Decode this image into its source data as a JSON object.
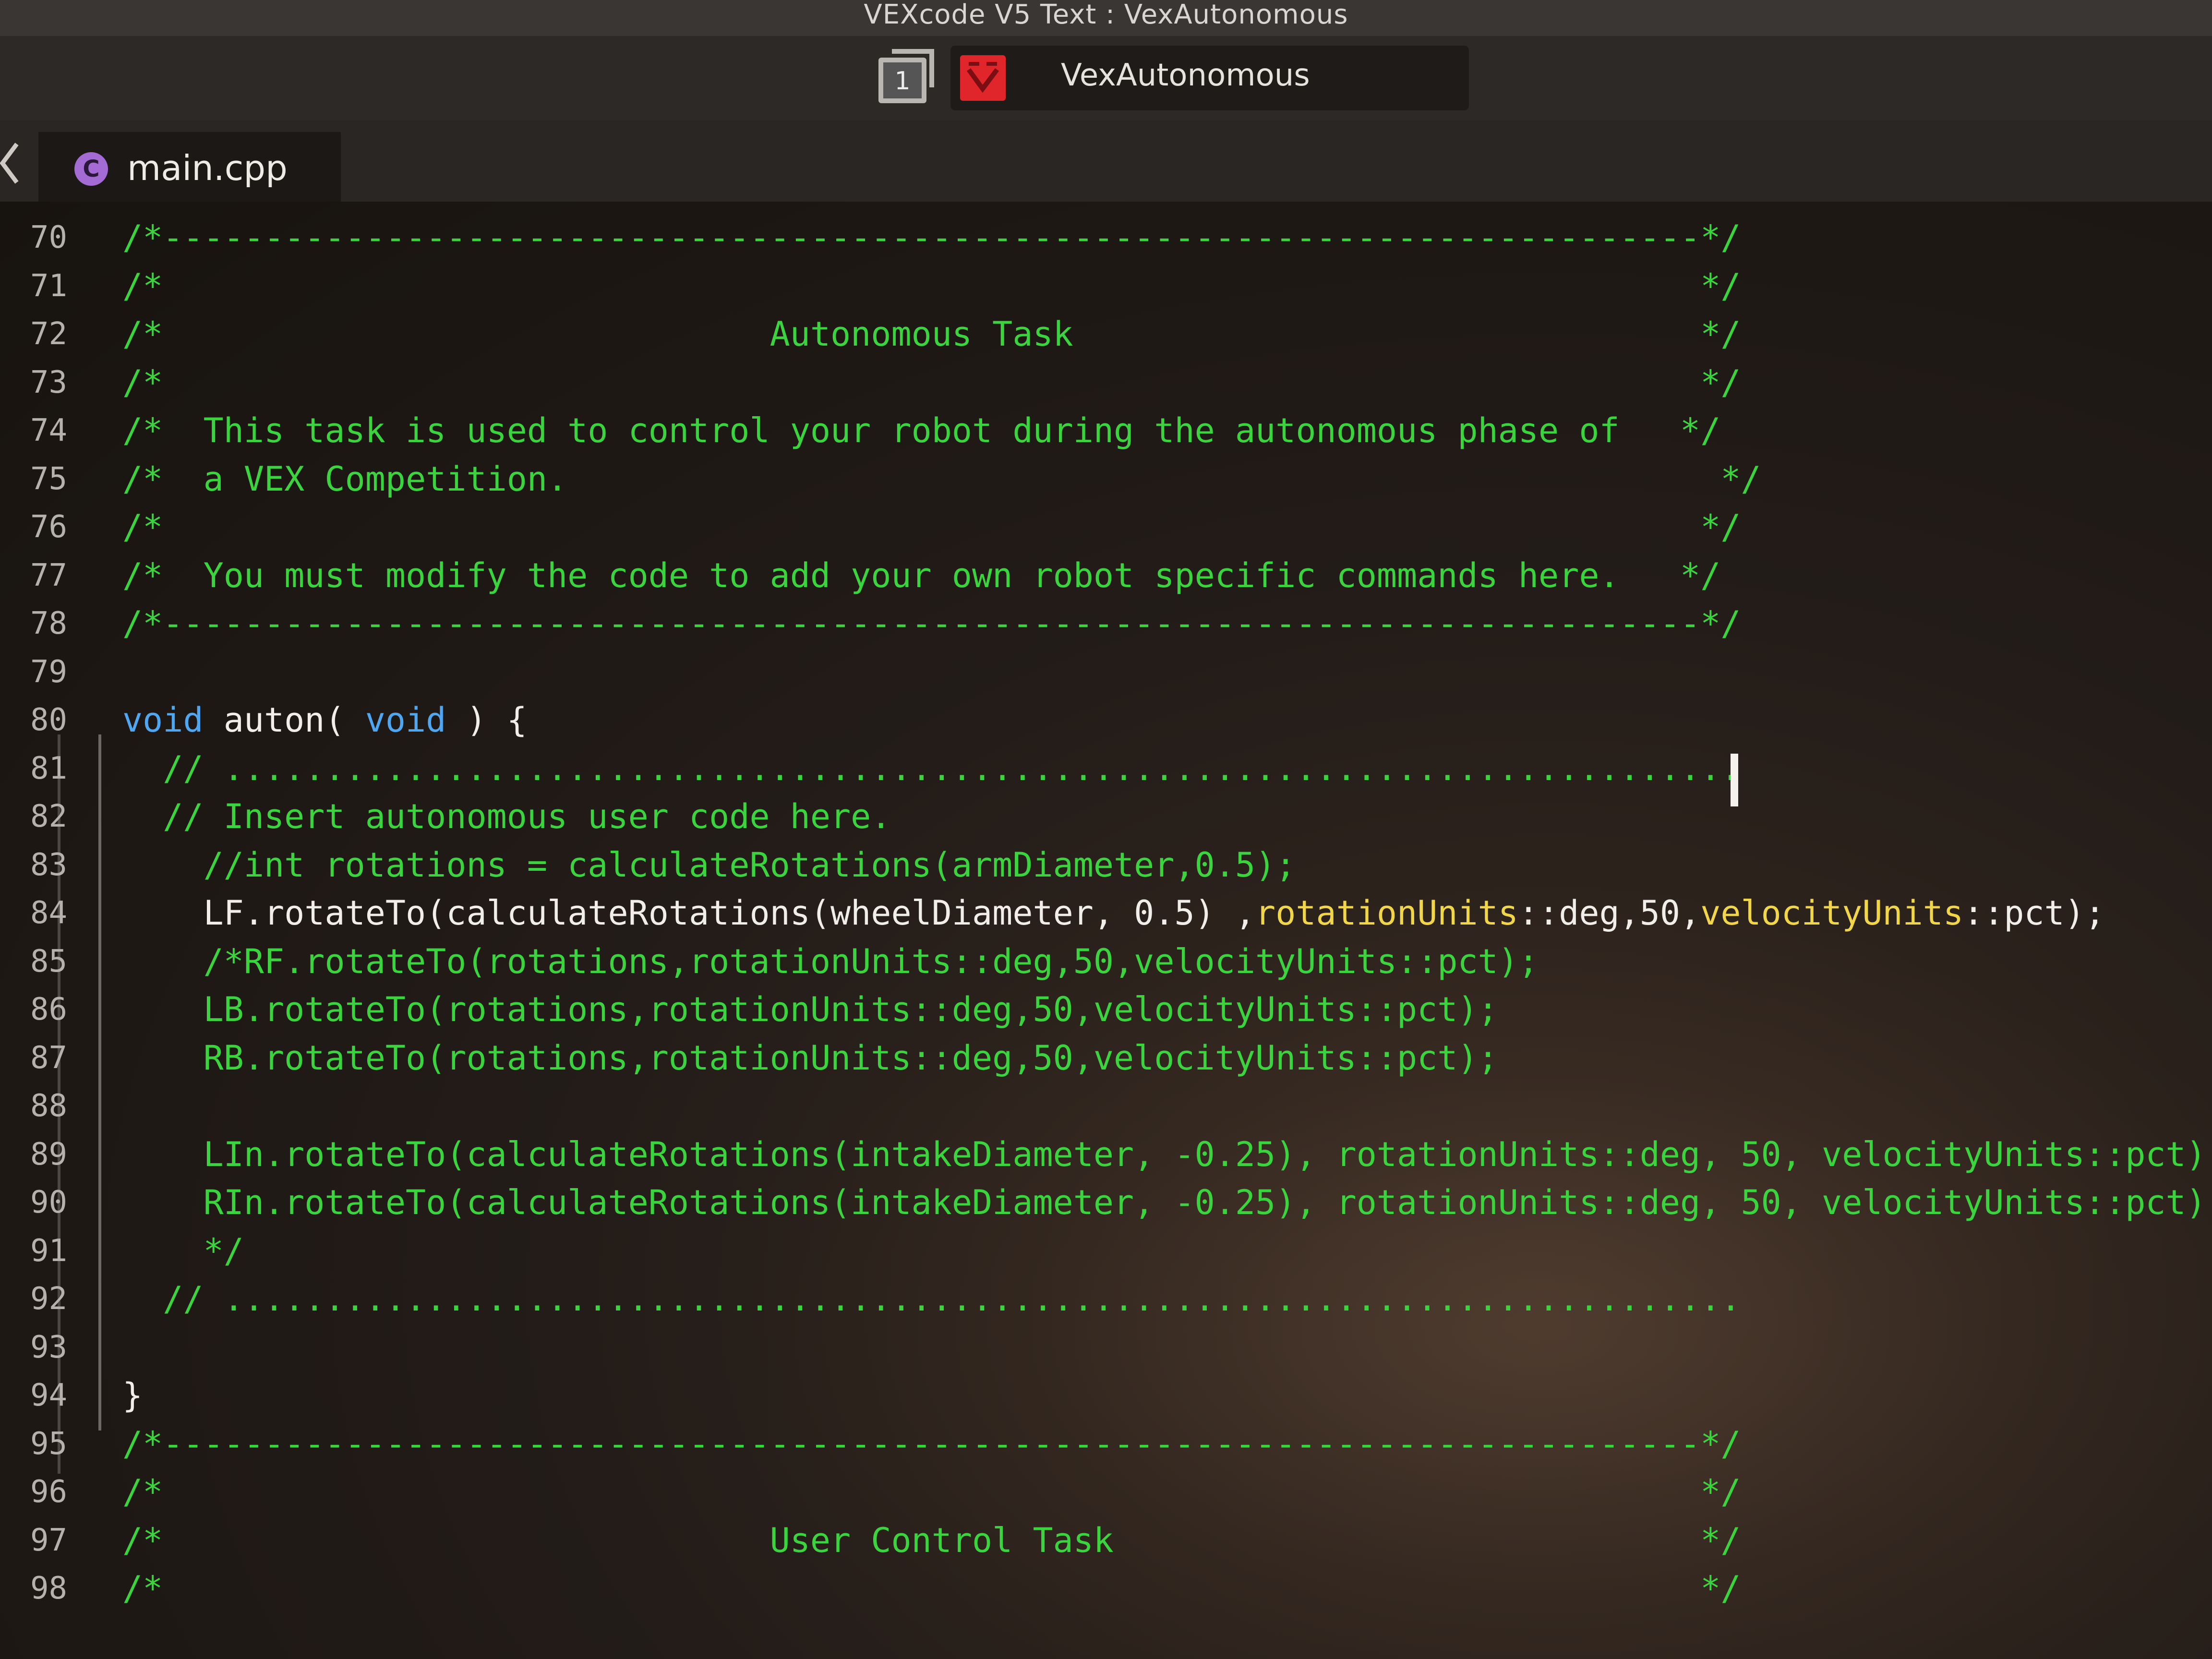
{
  "window": {
    "title": "VEXcode V5 Text : VexAutonomous"
  },
  "toolbar": {
    "slot_number": "1",
    "project_name": "VexAutonomous"
  },
  "file_tab": {
    "icon_glyph": "C",
    "name": "main.cpp"
  },
  "colors": {
    "comment": "#3bd43f",
    "keyword": "#4fa7f2",
    "plain": "#f1eeea",
    "type_highlight": "#f2d64a",
    "vex_red": "#e0262a"
  },
  "code_lines": [
    {
      "num": "70",
      "segments": [
        {
          "c": "comment",
          "t": "/*----------------------------------------------------------------------------*/"
        }
      ]
    },
    {
      "num": "71",
      "segments": [
        {
          "c": "comment",
          "t": "/*                                                                            */"
        }
      ]
    },
    {
      "num": "72",
      "segments": [
        {
          "c": "comment",
          "t": "/*                              Autonomous Task                               */"
        }
      ]
    },
    {
      "num": "73",
      "segments": [
        {
          "c": "comment",
          "t": "/*                                                                            */"
        }
      ]
    },
    {
      "num": "74",
      "segments": [
        {
          "c": "comment",
          "t": "/*  This task is used to control your robot during the autonomous phase of   */"
        }
      ]
    },
    {
      "num": "75",
      "segments": [
        {
          "c": "comment",
          "t": "/*  a VEX Competition.                                                         */"
        }
      ]
    },
    {
      "num": "76",
      "segments": [
        {
          "c": "comment",
          "t": "/*                                                                            */"
        }
      ]
    },
    {
      "num": "77",
      "segments": [
        {
          "c": "comment",
          "t": "/*  You must modify the code to add your own robot specific commands here.   */"
        }
      ]
    },
    {
      "num": "78",
      "segments": [
        {
          "c": "comment",
          "t": "/*----------------------------------------------------------------------------*/"
        }
      ]
    },
    {
      "num": "79",
      "segments": []
    },
    {
      "num": "80",
      "segments": [
        {
          "c": "keyword",
          "t": "void"
        },
        {
          "c": "plain",
          "t": " auton( "
        },
        {
          "c": "keyword",
          "t": "void"
        },
        {
          "c": "plain",
          "t": " ) {"
        }
      ]
    },
    {
      "num": "81",
      "segments": [
        {
          "c": "comment",
          "t": "  // ..........................................................................."
        }
      ]
    },
    {
      "num": "82",
      "segments": [
        {
          "c": "comment",
          "t": "  // Insert autonomous user code here."
        }
      ]
    },
    {
      "num": "83",
      "segments": [
        {
          "c": "comment",
          "t": "    //int rotations = calculateRotations(armDiameter,0.5);"
        }
      ]
    },
    {
      "num": "84",
      "segments": [
        {
          "c": "plain",
          "t": "    LF.rotateTo(calculateRotations(wheelDiameter, 0.5) ,"
        },
        {
          "c": "type",
          "t": "rotationUnits"
        },
        {
          "c": "plain",
          "t": "::deg,50,"
        },
        {
          "c": "type",
          "t": "velocityUnits"
        },
        {
          "c": "plain",
          "t": "::pct);"
        }
      ]
    },
    {
      "num": "85",
      "segments": [
        {
          "c": "comment",
          "t": "    /*RF.rotateTo(rotations,rotationUnits::deg,50,velocityUnits::pct);"
        }
      ]
    },
    {
      "num": "86",
      "segments": [
        {
          "c": "comment",
          "t": "    LB.rotateTo(rotations,rotationUnits::deg,50,velocityUnits::pct);"
        }
      ]
    },
    {
      "num": "87",
      "segments": [
        {
          "c": "comment",
          "t": "    RB.rotateTo(rotations,rotationUnits::deg,50,velocityUnits::pct);"
        }
      ]
    },
    {
      "num": "88",
      "segments": []
    },
    {
      "num": "89",
      "segments": [
        {
          "c": "comment",
          "t": "    LIn.rotateTo(calculateRotations(intakeDiameter, -0.25), rotationUnits::deg, 50, velocityUnits::pct);"
        }
      ]
    },
    {
      "num": "90",
      "segments": [
        {
          "c": "comment",
          "t": "    RIn.rotateTo(calculateRotations(intakeDiameter, -0.25), rotationUnits::deg, 50, velocityUnits::pct);"
        }
      ]
    },
    {
      "num": "91",
      "segments": [
        {
          "c": "comment",
          "t": "    */"
        }
      ]
    },
    {
      "num": "92",
      "segments": [
        {
          "c": "comment",
          "t": "  // ..........................................................................."
        }
      ]
    },
    {
      "num": "93",
      "segments": []
    },
    {
      "num": "94",
      "segments": [
        {
          "c": "plain",
          "t": "}"
        }
      ]
    },
    {
      "num": "95",
      "segments": [
        {
          "c": "comment",
          "t": "/*----------------------------------------------------------------------------*/"
        }
      ]
    },
    {
      "num": "96",
      "segments": [
        {
          "c": "comment",
          "t": "/*                                                                            */"
        }
      ]
    },
    {
      "num": "97",
      "segments": [
        {
          "c": "comment",
          "t": "/*                              User Control Task                             */"
        }
      ]
    },
    {
      "num": "98",
      "segments": [
        {
          "c": "comment",
          "t": "/*                                                                            */"
        }
      ]
    }
  ]
}
